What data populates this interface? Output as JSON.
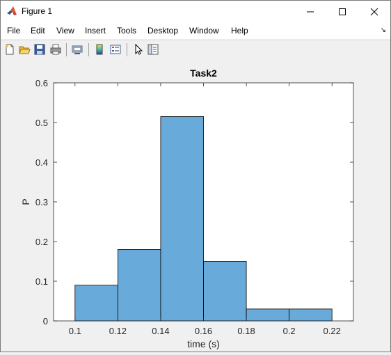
{
  "window": {
    "title": "Figure 1"
  },
  "menu": [
    "File",
    "Edit",
    "View",
    "Insert",
    "Tools",
    "Desktop",
    "Window",
    "Help"
  ],
  "toolbar_icons": [
    "new-figure-icon",
    "open-file-icon",
    "save-icon",
    "print-icon",
    "link-plot-icon",
    "colorbar-icon",
    "legend-icon",
    "edit-plot-icon",
    "property-inspector-icon"
  ],
  "colors": {
    "bar_fill": "#68aad9",
    "bar_edge": "#000000",
    "axes_bg": "#ffffff",
    "figure_bg": "#f0f0f0"
  },
  "chart_data": {
    "type": "bar",
    "title": "Task2",
    "xlabel": "time (s)",
    "ylabel": "P",
    "xlim": [
      0.09,
      0.23
    ],
    "ylim": [
      0,
      0.6
    ],
    "bin_edges": [
      0.1,
      0.12,
      0.14,
      0.16,
      0.18,
      0.2,
      0.22
    ],
    "values": [
      0.09,
      0.18,
      0.515,
      0.15,
      0.03,
      0.03
    ],
    "xticks": [
      "0.1",
      "0.12",
      "0.14",
      "0.16",
      "0.18",
      "0.2",
      "0.22"
    ],
    "xtick_values": [
      0.1,
      0.12,
      0.14,
      0.16,
      0.18,
      0.2,
      0.22
    ],
    "yticks": [
      "0",
      "0.1",
      "0.2",
      "0.3",
      "0.4",
      "0.5",
      "0.6"
    ],
    "ytick_values": [
      0,
      0.1,
      0.2,
      0.3,
      0.4,
      0.5,
      0.6
    ],
    "grid": false
  }
}
